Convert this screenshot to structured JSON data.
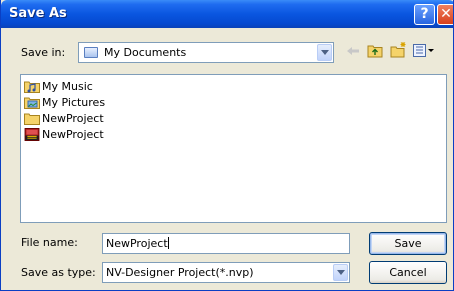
{
  "window": {
    "title": "Save As",
    "help_symbol": "?",
    "close_symbol": "✕"
  },
  "save_in": {
    "label": "Save in:",
    "value": "My Documents",
    "icon": "documents-folder-icon"
  },
  "toolbar": {
    "icons": [
      "back-arrow-icon",
      "up-folder-icon",
      "new-folder-icon",
      "view-menu-icon"
    ]
  },
  "files": [
    {
      "name": "My Music",
      "icon": "music-folder-icon"
    },
    {
      "name": "My Pictures",
      "icon": "pictures-folder-icon"
    },
    {
      "name": "NewProject",
      "icon": "folder-icon"
    },
    {
      "name": "NewProject",
      "icon": "nvp-file-icon"
    }
  ],
  "file_name": {
    "label": "File name:",
    "value": "NewProject"
  },
  "save_as_type": {
    "label": "Save as type:",
    "value": "NV-Designer Project(*.nvp)"
  },
  "buttons": {
    "save": "Save",
    "cancel": "Cancel"
  },
  "colors": {
    "titlebar": "#0a56e0",
    "dialog_bg": "#ece9d8",
    "border": "#7f9db9"
  }
}
